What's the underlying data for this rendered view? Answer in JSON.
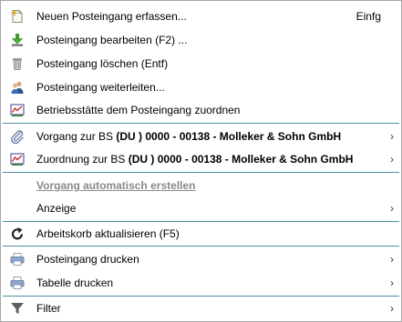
{
  "menu": {
    "items": [
      {
        "label": "Neuen Posteingang erfassen...",
        "shortcut": "Einfg",
        "icon": "new-document-icon"
      },
      {
        "label": "Posteingang bearbeiten (F2) ...",
        "icon": "edit-download-icon"
      },
      {
        "label": "Posteingang löschen (Entf)",
        "icon": "trash-icon"
      },
      {
        "label": "Posteingang weiterleiten...",
        "icon": "forward-users-icon"
      },
      {
        "label": "Betriebsstätte dem Posteingang zuordnen",
        "icon": "assign-chart-icon"
      },
      {
        "label_prefix": "Vorgang zur BS ",
        "label_bold": "(DU ) 0000 - 00138 - Molleker & Sohn GmbH",
        "icon": "paperclip-icon",
        "submenu": true
      },
      {
        "label_prefix": "Zuordnung zur BS ",
        "label_bold": "(DU ) 0000 - 00138 - Molleker & Sohn GmbH",
        "icon": "assign-chart-icon",
        "submenu": true
      },
      {
        "label": "Vorgang automatisch erstellen",
        "disabled": true
      },
      {
        "label": "Anzeige",
        "submenu": true
      },
      {
        "label": "Arbeitskorb aktualisieren (F5)",
        "icon": "refresh-icon"
      },
      {
        "label": "Posteingang drucken",
        "icon": "printer-icon",
        "submenu": true
      },
      {
        "label": "Tabelle drucken",
        "icon": "printer-icon",
        "submenu": true
      },
      {
        "label": "Filter",
        "icon": "filter-icon",
        "submenu": true
      }
    ],
    "chevron": "›",
    "colors": {
      "separator": "#4d8fa3",
      "disabled_text": "#8a8a8a",
      "border": "#a7a7a7"
    }
  }
}
